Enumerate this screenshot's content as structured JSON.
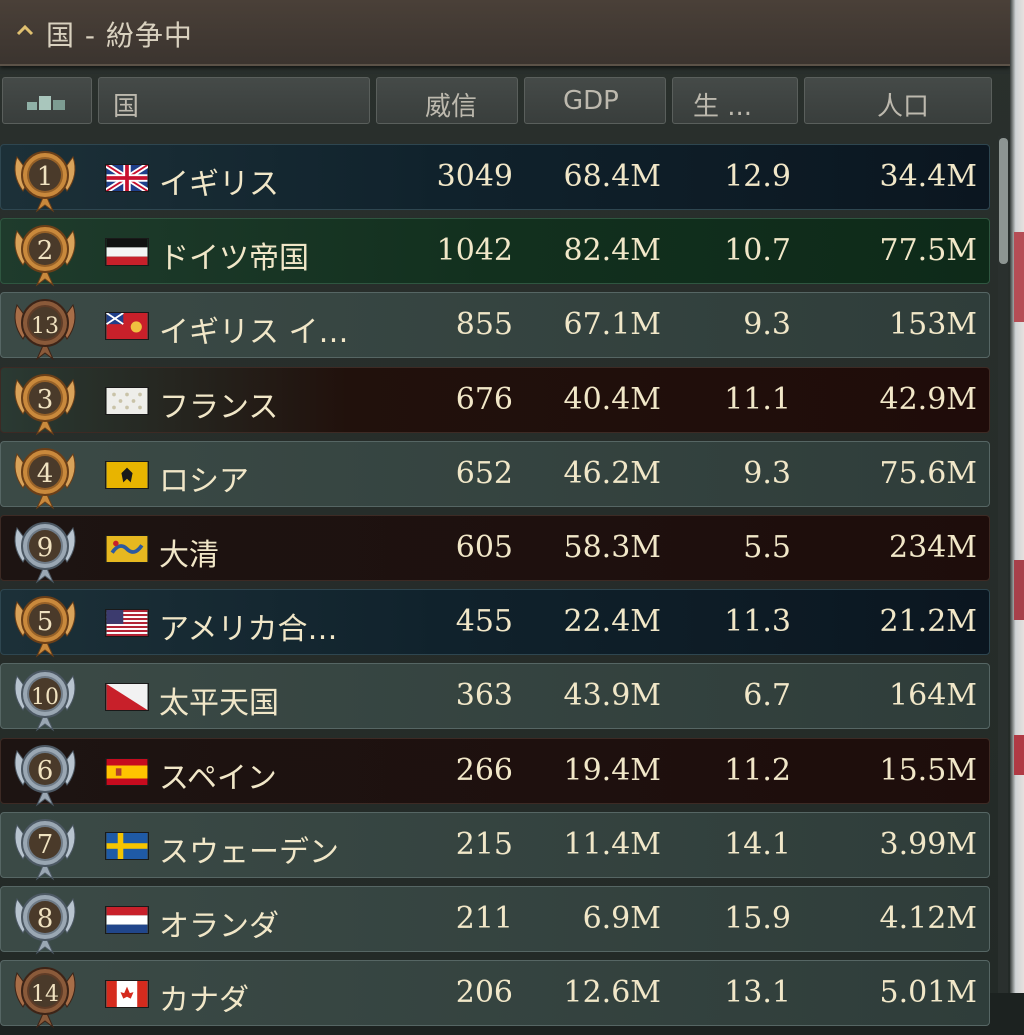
{
  "header": {
    "title": "国 - 紛争中"
  },
  "columns": {
    "rank_icon": "ranking-icon",
    "country": "国",
    "prestige": "威信",
    "gdp": "GDP",
    "sol": "生 ...",
    "population": "人口"
  },
  "rows": [
    {
      "rank": "1",
      "medal": "gold",
      "name": "イギリス",
      "prestige": "3049",
      "gdp": "68.4M",
      "sol": "12.9",
      "pop": "34.4M",
      "style": "blue",
      "flag": "uk"
    },
    {
      "rank": "2",
      "medal": "gold",
      "name": "ドイツ帝国",
      "prestige": "1042",
      "gdp": "82.4M",
      "sol": "10.7",
      "pop": "77.5M",
      "style": "green",
      "flag": "germany"
    },
    {
      "rank": "13",
      "medal": "bronze",
      "name": "イギリス イ…",
      "prestige": "855",
      "gdp": "67.1M",
      "sol": "9.3",
      "pop": "153M",
      "style": "gray",
      "flag": "india"
    },
    {
      "rank": "3",
      "medal": "gold",
      "name": "フランス",
      "prestige": "676",
      "gdp": "40.4M",
      "sol": "11.1",
      "pop": "42.9M",
      "style": "maroon",
      "flag": "france"
    },
    {
      "rank": "4",
      "medal": "gold",
      "name": "ロシア",
      "prestige": "652",
      "gdp": "46.2M",
      "sol": "9.3",
      "pop": "75.6M",
      "style": "gray",
      "flag": "russia"
    },
    {
      "rank": "9",
      "medal": "silver",
      "name": "大清",
      "prestige": "605",
      "gdp": "58.3M",
      "sol": "5.5",
      "pop": "234M",
      "style": "maroon2",
      "flag": "qing"
    },
    {
      "rank": "5",
      "medal": "gold",
      "name": "アメリカ合…",
      "prestige": "455",
      "gdp": "22.4M",
      "sol": "11.3",
      "pop": "21.2M",
      "style": "blue",
      "flag": "usa"
    },
    {
      "rank": "10",
      "medal": "silver",
      "name": "太平天国",
      "prestige": "363",
      "gdp": "43.9M",
      "sol": "6.7",
      "pop": "164M",
      "style": "gray",
      "flag": "taiping"
    },
    {
      "rank": "6",
      "medal": "silver",
      "name": "スペイン",
      "prestige": "266",
      "gdp": "19.4M",
      "sol": "11.2",
      "pop": "15.5M",
      "style": "maroon2",
      "flag": "spain"
    },
    {
      "rank": "7",
      "medal": "silver",
      "name": "スウェーデン",
      "prestige": "215",
      "gdp": "11.4M",
      "sol": "14.1",
      "pop": "3.99M",
      "style": "gray",
      "flag": "sweden"
    },
    {
      "rank": "8",
      "medal": "silver",
      "name": "オランダ",
      "prestige": "211",
      "gdp": "6.9M",
      "sol": "15.9",
      "pop": "4.12M",
      "style": "gray",
      "flag": "netherlands"
    },
    {
      "rank": "14",
      "medal": "bronze",
      "name": "カナダ",
      "prestige": "206",
      "gdp": "12.6M",
      "sol": "13.1",
      "pop": "5.01M",
      "style": "gray",
      "flag": "canada"
    }
  ]
}
